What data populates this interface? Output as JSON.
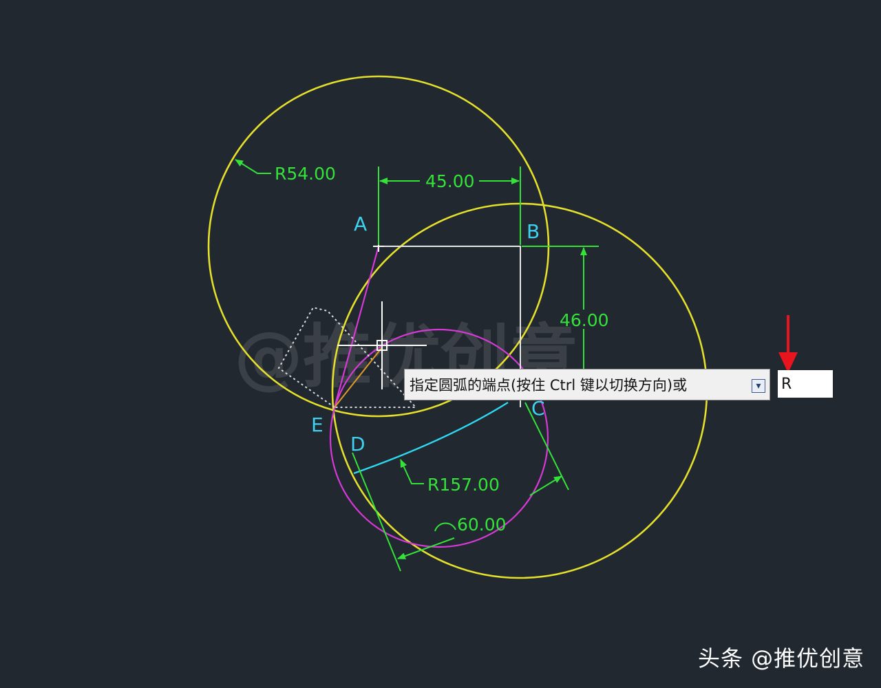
{
  "watermark_center": "@推优创意",
  "source_watermark": "头条 @推优创意",
  "dimensions": {
    "radius_large_circle": "R54.00",
    "horizontal_ab": "45.00",
    "vertical_bc": "46.00",
    "radius_arc": "R157.00",
    "angle": "60.00"
  },
  "points": {
    "a": "A",
    "b": "B",
    "c": "C",
    "d": "D",
    "e": "E"
  },
  "command_prompt": {
    "text": "指定圆弧的端点(按住 Ctrl 键以切换方向)或",
    "input_value": "R"
  },
  "colors": {
    "background": "#212830",
    "circle": "#e5e02b",
    "magenta": "#d63ad6",
    "dimension": "#35e23a",
    "arc": "#2fd8f0",
    "point_label": "#3fd2f0",
    "arrow": "#e8141e"
  },
  "icons": {
    "prompt_dropdown": "dropdown-icon",
    "crosshair": "crosshair-icon"
  }
}
